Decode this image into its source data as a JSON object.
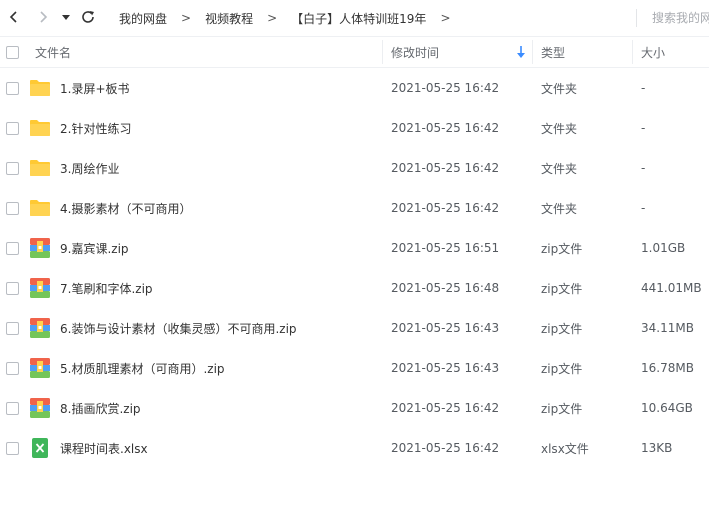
{
  "toolbar": {
    "back_icon": "chevron-left-icon",
    "forward_icon": "chevron-right-icon",
    "history_icon": "caret-down-icon",
    "refresh_icon": "refresh-icon"
  },
  "breadcrumb": {
    "items": [
      "我的网盘",
      "视频教程",
      "【白子】人体特训班19年"
    ],
    "separator": ">"
  },
  "search": {
    "placeholder": "搜索我的网盘文件"
  },
  "columns": {
    "name": "文件名",
    "modified": "修改时间",
    "type": "类型",
    "size": "大小"
  },
  "sort": {
    "column": "modified",
    "direction": "descending",
    "icon": "arrow-down-icon",
    "color": "#3b8cff"
  },
  "colors": {
    "folder": "#ffc933",
    "zip_top": "#f0634b",
    "zip_middle": "#4f9ef5",
    "zip_bottom": "#74c55a",
    "xlsx": "#3fb65a"
  },
  "files": [
    {
      "name": "1.录屏+板书",
      "modified": "2021-05-25 16:42",
      "type": "文件夹",
      "size": "-",
      "kind": "folder"
    },
    {
      "name": "2.针对性练习",
      "modified": "2021-05-25 16:42",
      "type": "文件夹",
      "size": "-",
      "kind": "folder"
    },
    {
      "name": "3.周绘作业",
      "modified": "2021-05-25 16:42",
      "type": "文件夹",
      "size": "-",
      "kind": "folder"
    },
    {
      "name": "4.摄影素材（不可商用）",
      "modified": "2021-05-25 16:42",
      "type": "文件夹",
      "size": "-",
      "kind": "folder"
    },
    {
      "name": "9.嘉宾课.zip",
      "modified": "2021-05-25 16:51",
      "type": "zip文件",
      "size": "1.01GB",
      "kind": "zip"
    },
    {
      "name": "7.笔刷和字体.zip",
      "modified": "2021-05-25 16:48",
      "type": "zip文件",
      "size": "441.01MB",
      "kind": "zip"
    },
    {
      "name": "6.装饰与设计素材（收集灵感）不可商用.zip",
      "modified": "2021-05-25 16:43",
      "type": "zip文件",
      "size": "34.11MB",
      "kind": "zip"
    },
    {
      "name": "5.材质肌理素材（可商用）.zip",
      "modified": "2021-05-25 16:43",
      "type": "zip文件",
      "size": "16.78MB",
      "kind": "zip"
    },
    {
      "name": "8.插画欣赏.zip",
      "modified": "2021-05-25 16:42",
      "type": "zip文件",
      "size": "10.64GB",
      "kind": "zip"
    },
    {
      "name": "课程时间表.xlsx",
      "modified": "2021-05-25 16:42",
      "type": "xlsx文件",
      "size": "13KB",
      "kind": "xlsx"
    }
  ]
}
